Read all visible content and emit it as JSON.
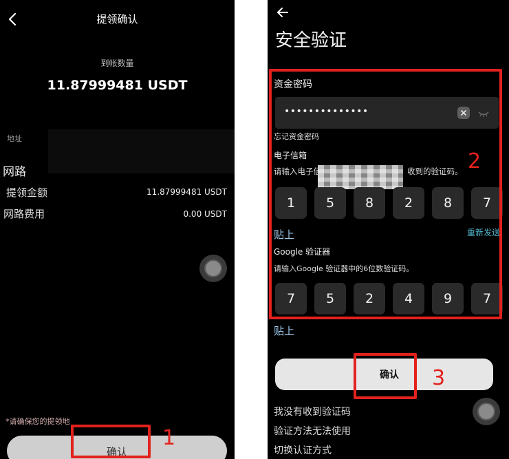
{
  "left": {
    "title": "提领确认",
    "amount_label": "到帐数量",
    "amount_value": "11.87999481 USDT",
    "address_label": "地址",
    "network_label": "网路",
    "rows": [
      {
        "label": "提领金额",
        "value": "11.87999481 USDT"
      },
      {
        "label": "网路费用",
        "value": "0.00 USDT"
      }
    ],
    "notice": "*请确保您的提领地",
    "confirm_label": "确认",
    "icons": {
      "back": "chevron-left-icon",
      "assistive": "assistive-touch-icon"
    }
  },
  "right": {
    "title": "安全验证",
    "fund_password": {
      "label": "资金密码",
      "value": "••••••••••••••",
      "forgot": "忘记资金密码"
    },
    "email": {
      "label": "电子信箱",
      "hint_start": "请输入电子信",
      "hint_end": "收到的验证码。",
      "code": [
        "1",
        "5",
        "8",
        "2",
        "8",
        "7"
      ],
      "paste": "贴上",
      "resend": "重新发送"
    },
    "google": {
      "label": "Google 验证器",
      "hint": "请输入Google 验证器中的6位数验证码。",
      "code": [
        "7",
        "5",
        "2",
        "4",
        "9",
        "7"
      ],
      "paste": "贴上"
    },
    "confirm_label": "确认",
    "links": [
      "我没有收到验证码",
      "验证方法无法使用",
      "切换认证方式"
    ],
    "icons": {
      "back": "arrow-left-icon",
      "clear": "clear-icon",
      "visibility": "eye-closed-icon",
      "assistive": "assistive-touch-icon"
    }
  },
  "annotations": {
    "step1": "1",
    "step2": "2",
    "step3": "3"
  },
  "colors": {
    "annotation": "#e3211d",
    "link": "#4fb3c9",
    "paste": "#9fc8e8",
    "background": "#000000",
    "button": "#e6e6e6"
  }
}
